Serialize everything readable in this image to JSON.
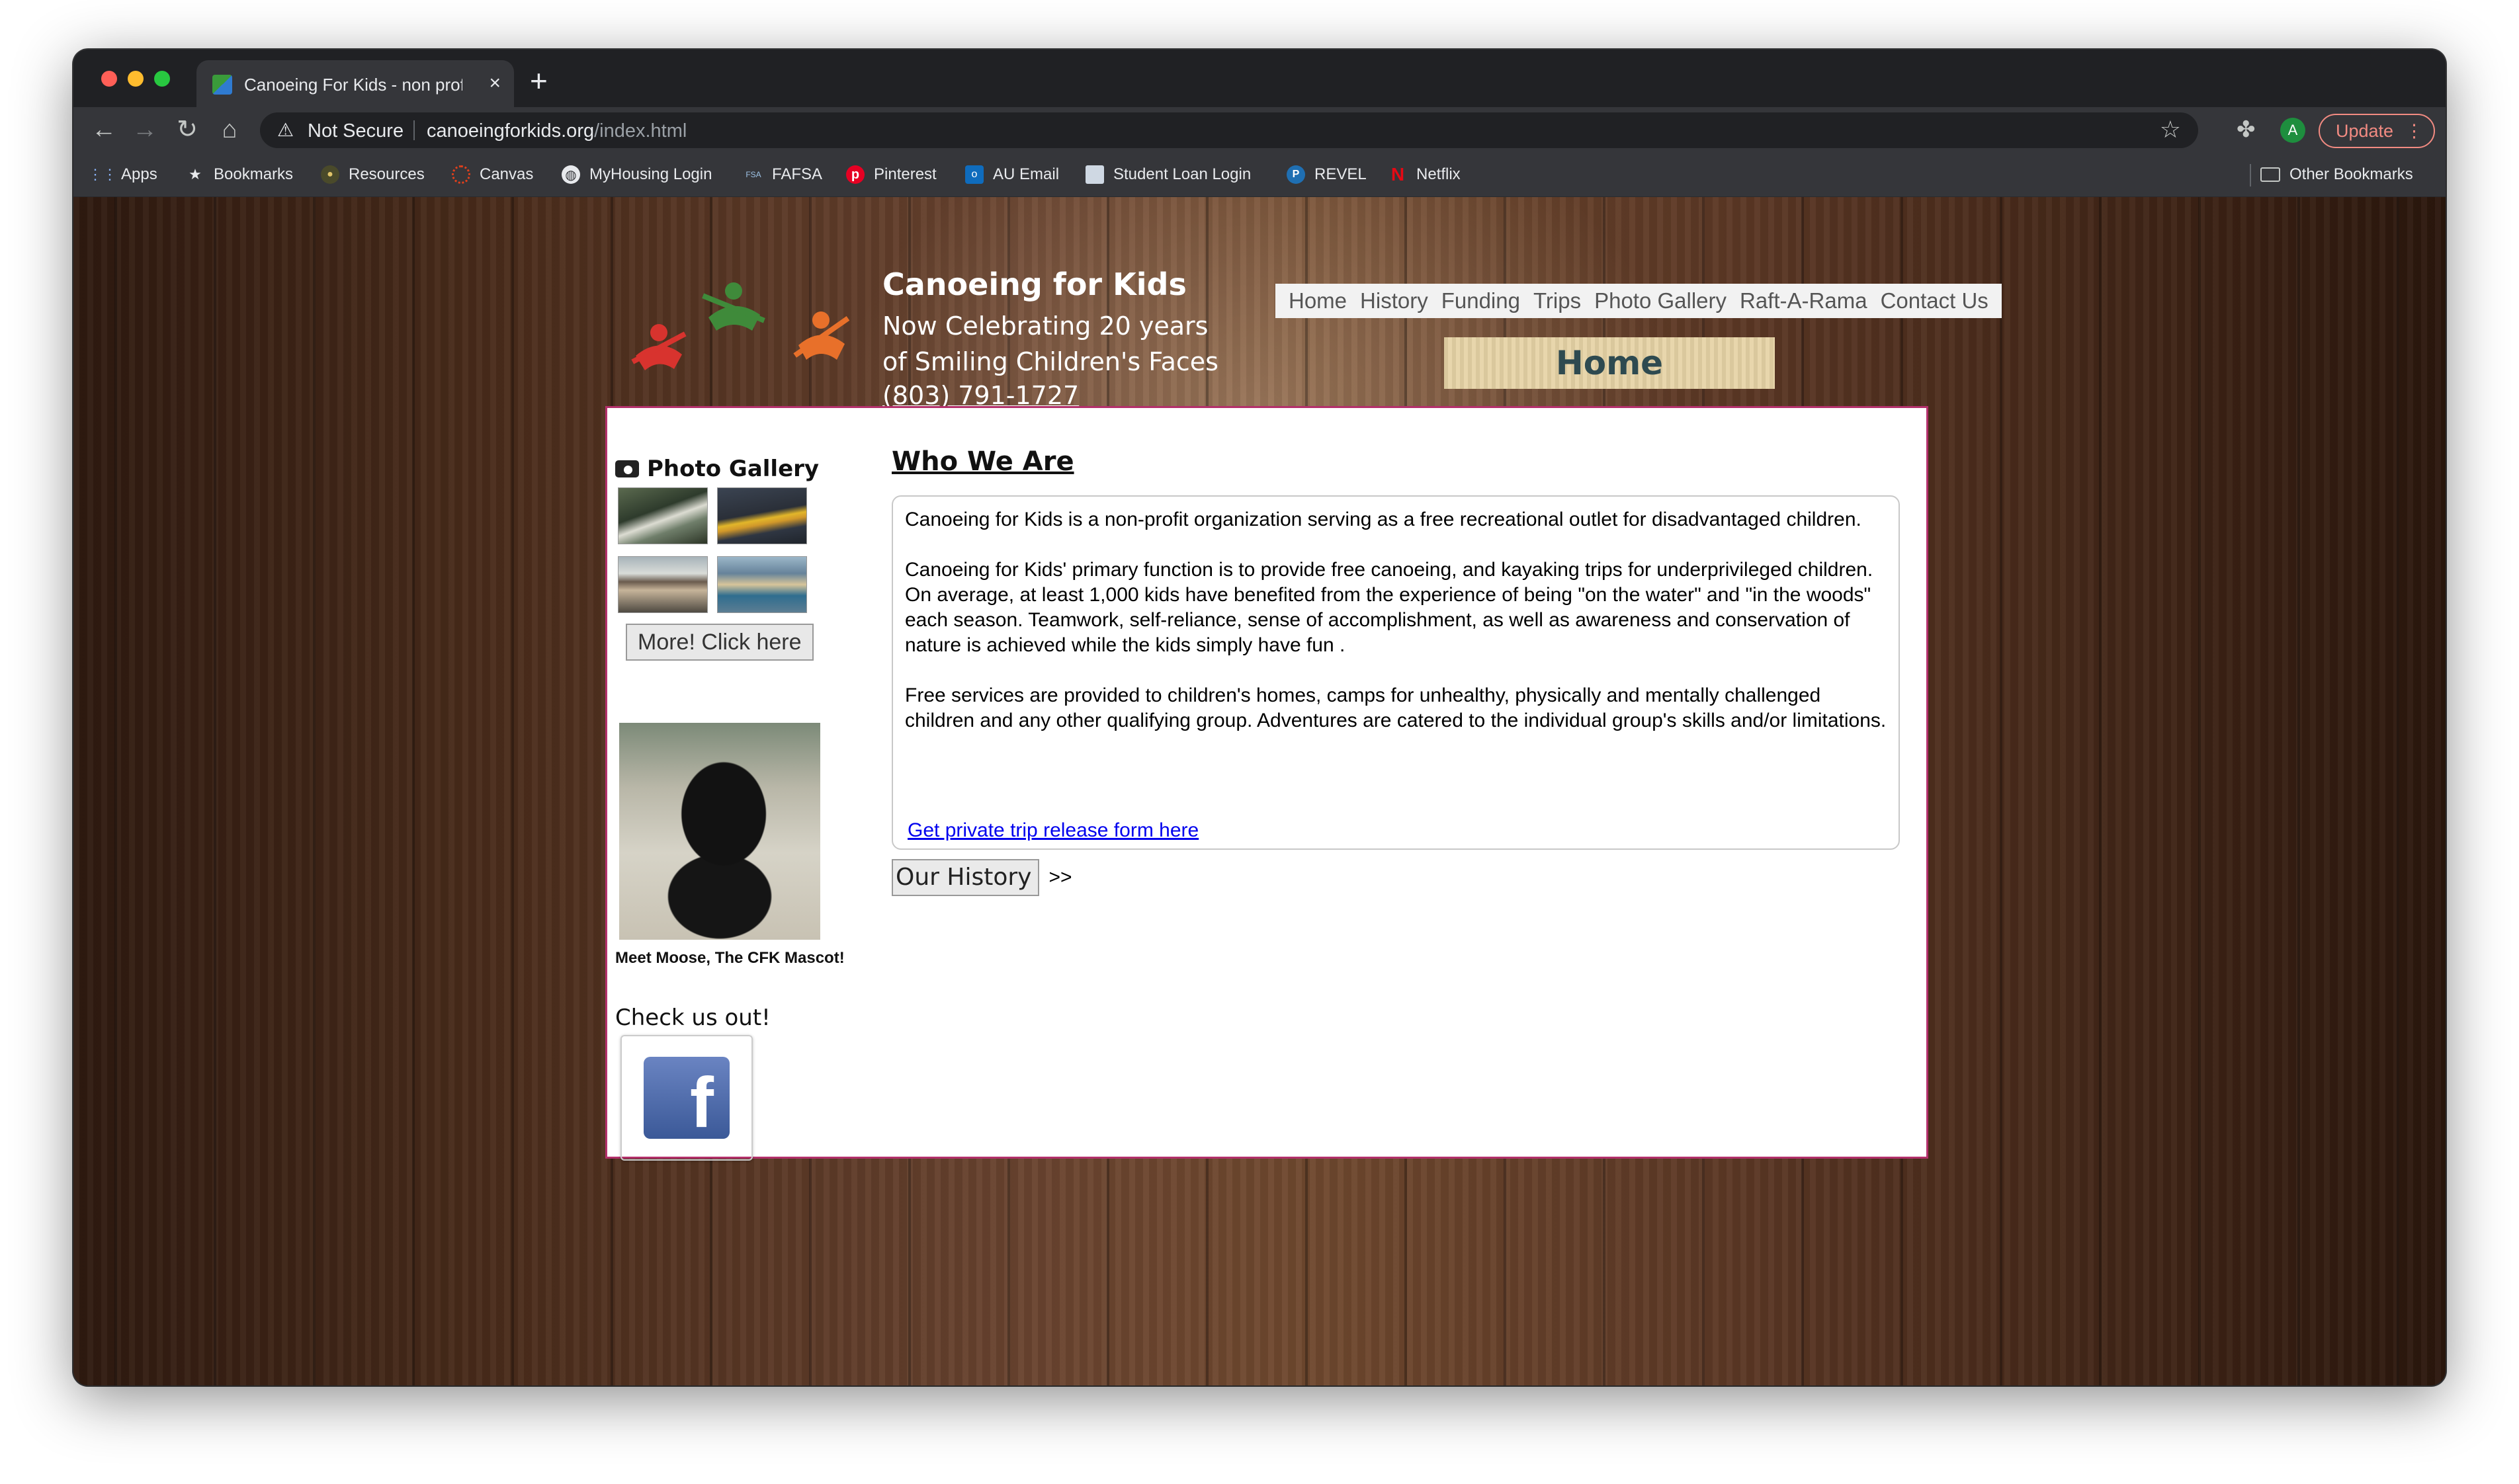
{
  "browser": {
    "tab_title": "Canoeing For Kids - non profit",
    "tab_close": "×",
    "new_tab": "+",
    "security_label": "Not Secure",
    "url_domain": "canoeingforkids.org",
    "url_path": "/index.html",
    "update_label": "Update",
    "avatar_letter": "A"
  },
  "bookmarks": [
    {
      "label": "Apps",
      "icon": "apps-grid-icon"
    },
    {
      "label": "Bookmarks",
      "icon": "star-icon"
    },
    {
      "label": "Resources",
      "icon": "resources-icon"
    },
    {
      "label": "Canvas",
      "icon": "canvas-icon"
    },
    {
      "label": "MyHousing Login",
      "icon": "globe-icon"
    },
    {
      "label": "FAFSA",
      "icon": "fafsa-icon"
    },
    {
      "label": "Pinterest",
      "icon": "pinterest-icon"
    },
    {
      "label": "AU Email",
      "icon": "outlook-icon"
    },
    {
      "label": "Student Loan Login",
      "icon": "document-icon"
    },
    {
      "label": "REVEL",
      "icon": "revel-icon"
    },
    {
      "label": "Netflix",
      "icon": "netflix-icon"
    }
  ],
  "other_bookmarks": "Other Bookmarks",
  "site": {
    "title": "Canoeing for Kids",
    "tagline": "Now Celebrating 20 years of Smiling Children's Faces",
    "phone": "(803) 791-1727",
    "nav": [
      "Home",
      "History",
      "Funding",
      "Trips",
      "Photo Gallery",
      "Raft-A-Rama",
      "Contact Us"
    ],
    "current_page": "Home"
  },
  "sidebar": {
    "gallery_heading": "Photo Gallery",
    "more_button": "More! Click here",
    "mascot_caption": "Meet Moose, The CFK Mascot!",
    "check_us_out": "Check us out!",
    "facebook_letter": "f"
  },
  "main": {
    "heading": "Who We Are",
    "paragraphs": [
      "Canoeing for Kids is a non-profit organization serving as a free recreational outlet for disadvantaged children.",
      "Canoeing for Kids' primary function is to provide free canoeing, and kayaking trips for underprivileged children.  On average, at least  1,000 kids have benefited from the experience of being \"on the water\" and \"in the woods\" each season. Teamwork, self-reliance, sense of accomplishment, as well as awareness and conservation of nature is achieved while the kids simply have fun .",
      "Free services are provided to children's homes, camps for unhealthy, physically and mentally challenged children and any other qualifying group. Adventures are catered to the individual group's skills and/or limitations."
    ],
    "release_link": "Get private trip release form here",
    "history_button": "Our History",
    "history_arrows": ">>"
  }
}
